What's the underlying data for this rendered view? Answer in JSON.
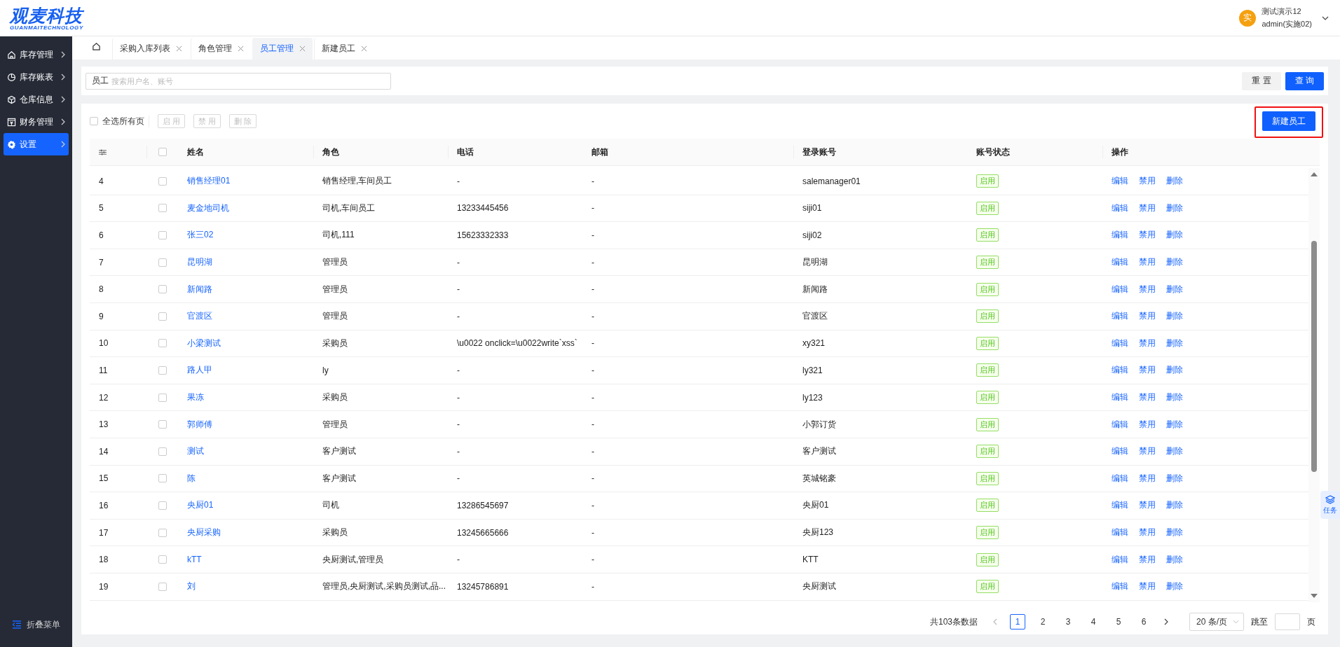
{
  "logo": {
    "title": "观麦科技",
    "subtitle": "GUANMAITECHNOLOGY"
  },
  "user": {
    "avatar": "实",
    "name": "测试演示12",
    "account": "admin(实施02)"
  },
  "sidebar": {
    "items": [
      {
        "label": "库存管理",
        "selected": false
      },
      {
        "label": "库存账表",
        "selected": false
      },
      {
        "label": "仓库信息",
        "selected": false
      },
      {
        "label": "财务管理",
        "selected": false
      },
      {
        "label": "设置",
        "selected": true
      }
    ],
    "collapse": "折叠菜单"
  },
  "tabs": [
    {
      "label": "采购入库列表",
      "selected": false
    },
    {
      "label": "角色管理",
      "selected": false
    },
    {
      "label": "员工管理",
      "selected": true
    },
    {
      "label": "新建员工",
      "selected": false
    }
  ],
  "search": {
    "label": "员工",
    "placeholder": "搜索用户名、账号",
    "buttons": [
      {
        "label": "重 置",
        "kind": "default"
      },
      {
        "label": "查 询",
        "kind": "primary"
      }
    ]
  },
  "toolbar": {
    "select_all": {
      "label": "全选所有页",
      "checked": false
    },
    "bulk_buttons": [
      {
        "label": "启 用",
        "disabled": true
      },
      {
        "label": "禁 用",
        "disabled": true
      },
      {
        "label": "删 除",
        "disabled": true
      }
    ],
    "new_button": {
      "label": "新建员工",
      "highlighted": true
    }
  },
  "table": {
    "columns": [
      "姓名",
      "角色",
      "电话",
      "邮箱",
      "登录账号",
      "账号状态",
      "操作"
    ],
    "header_checked": false,
    "rows": [
      {
        "seq": "4",
        "checked": false,
        "name": "销售经理01",
        "role": "销售经理,车间员工",
        "phone": "-",
        "email": "-",
        "login": "salemanager01",
        "status": "启用",
        "actions": [
          "编辑",
          "禁用",
          "删除"
        ]
      },
      {
        "seq": "5",
        "checked": false,
        "name": "麦金地司机",
        "role": "司机,车间员工",
        "phone": "13233445456",
        "email": "-",
        "login": "siji01",
        "status": "启用",
        "actions": [
          "编辑",
          "禁用",
          "删除"
        ]
      },
      {
        "seq": "6",
        "checked": false,
        "name": "张三02",
        "role": "司机,111",
        "phone": "15623332333",
        "email": "-",
        "login": "siji02",
        "status": "启用",
        "actions": [
          "编辑",
          "禁用",
          "删除"
        ]
      },
      {
        "seq": "7",
        "checked": false,
        "name": "昆明湖",
        "role": "管理员",
        "phone": "-",
        "email": "-",
        "login": "昆明湖",
        "status": "启用",
        "actions": [
          "编辑",
          "禁用",
          "删除"
        ]
      },
      {
        "seq": "8",
        "checked": false,
        "name": "新闻路",
        "role": "管理员",
        "phone": "-",
        "email": "-",
        "login": "新闻路",
        "status": "启用",
        "actions": [
          "编辑",
          "禁用",
          "删除"
        ]
      },
      {
        "seq": "9",
        "checked": false,
        "name": "官渡区",
        "role": "管理员",
        "phone": "-",
        "email": "-",
        "login": "官渡区",
        "status": "启用",
        "actions": [
          "编辑",
          "禁用",
          "删除"
        ]
      },
      {
        "seq": "10",
        "checked": false,
        "name": "小梁测试",
        "role": "采购员",
        "phone": "\\u0022 onclick=\\u0022write`xss`",
        "email": "-",
        "login": "xy321",
        "status": "启用",
        "actions": [
          "编辑",
          "禁用",
          "删除"
        ]
      },
      {
        "seq": "11",
        "checked": false,
        "name": "路人甲",
        "role": "ly",
        "phone": "-",
        "email": "-",
        "login": "ly321",
        "status": "启用",
        "actions": [
          "编辑",
          "禁用",
          "删除"
        ]
      },
      {
        "seq": "12",
        "checked": false,
        "name": "果冻",
        "role": "采购员",
        "phone": "-",
        "email": "-",
        "login": "ly123",
        "status": "启用",
        "actions": [
          "编辑",
          "禁用",
          "删除"
        ]
      },
      {
        "seq": "13",
        "checked": false,
        "name": "郭师傅",
        "role": "管理员",
        "phone": "-",
        "email": "-",
        "login": "小郭订货",
        "status": "启用",
        "actions": [
          "编辑",
          "禁用",
          "删除"
        ]
      },
      {
        "seq": "14",
        "checked": false,
        "name": "测试",
        "role": "客户测试",
        "phone": "-",
        "email": "-",
        "login": "客户测试",
        "status": "启用",
        "actions": [
          "编辑",
          "禁用",
          "删除"
        ]
      },
      {
        "seq": "15",
        "checked": false,
        "name": "陈",
        "role": "客户测试",
        "phone": "-",
        "email": "-",
        "login": "英城铭豪",
        "status": "启用",
        "actions": [
          "编辑",
          "禁用",
          "删除"
        ]
      },
      {
        "seq": "16",
        "checked": false,
        "name": "央厨01",
        "role": "司机",
        "phone": "13286545697",
        "email": "-",
        "login": "央厨01",
        "status": "启用",
        "actions": [
          "编辑",
          "禁用",
          "删除"
        ]
      },
      {
        "seq": "17",
        "checked": false,
        "name": "央厨采购",
        "role": "采购员",
        "phone": "13245665666",
        "email": "-",
        "login": "央厨123",
        "status": "启用",
        "actions": [
          "编辑",
          "禁用",
          "删除"
        ]
      },
      {
        "seq": "18",
        "checked": false,
        "name": "kTT",
        "role": "央厨测试,管理员",
        "phone": "-",
        "email": "-",
        "login": "KTT",
        "status": "启用",
        "actions": [
          "编辑",
          "禁用",
          "删除"
        ]
      },
      {
        "seq": "19",
        "checked": false,
        "name": "刘",
        "role": "管理员,央厨测试,采购员测试,品...",
        "phone": "13245786891",
        "email": "-",
        "login": "央厨测试",
        "status": "启用",
        "actions": [
          "编辑",
          "禁用",
          "删除"
        ]
      }
    ]
  },
  "pagination": {
    "total": "共103条数据",
    "pages": [
      {
        "label": "1",
        "selected": true
      },
      {
        "label": "2",
        "selected": false
      },
      {
        "label": "3",
        "selected": false
      },
      {
        "label": "4",
        "selected": false
      },
      {
        "label": "5",
        "selected": false
      },
      {
        "label": "6",
        "selected": false
      }
    ],
    "page_size": "20 条/页",
    "jump_label": "跳至",
    "page_suffix": "页"
  },
  "side_tab": {
    "label": "任务"
  }
}
